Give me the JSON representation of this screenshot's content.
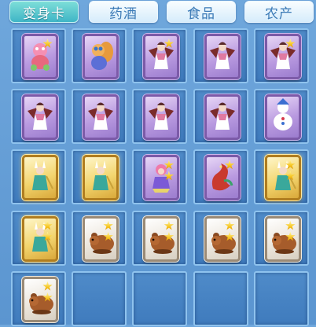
{
  "tabs": [
    {
      "label": "变身卡",
      "active": true
    },
    {
      "label": "药酒",
      "active": false
    },
    {
      "label": "食品",
      "active": false
    },
    {
      "label": "农产",
      "active": false
    }
  ],
  "grid": {
    "columns": 5,
    "rows": 5,
    "cells": [
      {
        "card": "purple",
        "figure": "pink-monster",
        "stars": 1
      },
      {
        "card": "purple",
        "figure": "squirrel-critter",
        "stars": 0
      },
      {
        "card": "purple",
        "figure": "winged-fairy",
        "stars": 1
      },
      {
        "card": "purple",
        "figure": "winged-fairy",
        "stars": 0
      },
      {
        "card": "purple",
        "figure": "winged-fairy",
        "stars": 1
      },
      {
        "card": "purple",
        "figure": "winged-fairy",
        "stars": 0
      },
      {
        "card": "purple",
        "figure": "winged-fairy",
        "stars": 0
      },
      {
        "card": "purple",
        "figure": "winged-fairy",
        "stars": 0
      },
      {
        "card": "purple",
        "figure": "winged-fairy",
        "stars": 0
      },
      {
        "card": "purple",
        "figure": "snow-doll",
        "stars": 0
      },
      {
        "card": "gold",
        "figure": "rabbit-warrior",
        "stars": 0
      },
      {
        "card": "gold",
        "figure": "rabbit-warrior",
        "stars": 0
      },
      {
        "card": "purple",
        "figure": "pink-hair-girl",
        "stars": 2
      },
      {
        "card": "purple",
        "figure": "red-dragon",
        "stars": 1
      },
      {
        "card": "gold",
        "figure": "rabbit-warrior",
        "stars": 2
      },
      {
        "card": "gold",
        "figure": "rabbit-warrior",
        "stars": 2
      },
      {
        "card": "silver",
        "figure": "brown-bear",
        "stars": 2
      },
      {
        "card": "silver",
        "figure": "brown-bear",
        "stars": 2
      },
      {
        "card": "silver",
        "figure": "brown-bear",
        "stars": 2
      },
      {
        "card": "silver",
        "figure": "brown-bear",
        "stars": 2
      },
      {
        "card": "silver",
        "figure": "brown-bear",
        "stars": 2
      },
      {
        "card": null,
        "figure": null,
        "stars": 0
      },
      {
        "card": null,
        "figure": null,
        "stars": 0
      },
      {
        "card": null,
        "figure": null,
        "stars": 0
      },
      {
        "card": null,
        "figure": null,
        "stars": 0
      }
    ]
  },
  "colors": {
    "panel_bg": "#5b95d0",
    "slot_border": "#8fc3ee",
    "active_tab": "#3fb5c6",
    "inactive_tab": "#eaf6ff",
    "star_gold": "#f6c21a"
  }
}
